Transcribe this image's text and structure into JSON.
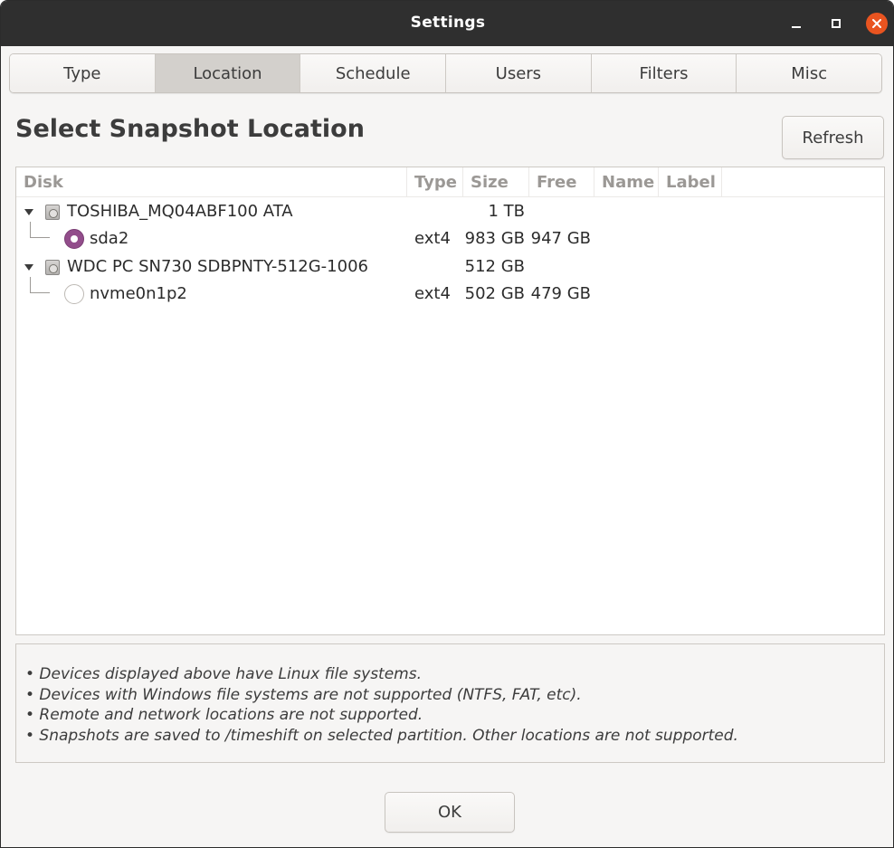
{
  "window": {
    "title": "Settings"
  },
  "tabs": [
    {
      "label": "Type",
      "active": false
    },
    {
      "label": "Location",
      "active": true
    },
    {
      "label": "Schedule",
      "active": false
    },
    {
      "label": "Users",
      "active": false
    },
    {
      "label": "Filters",
      "active": false
    },
    {
      "label": "Misc",
      "active": false
    }
  ],
  "page": {
    "heading": "Select Snapshot Location",
    "refresh_label": "Refresh"
  },
  "columns": [
    "Disk",
    "Type",
    "Size",
    "Free",
    "Name",
    "Label"
  ],
  "rows": [
    {
      "kind": "disk",
      "disk": "TOSHIBA_MQ04ABF100 ATA",
      "type": "",
      "size": "1 TB",
      "free": "",
      "name": "",
      "label": ""
    },
    {
      "kind": "partition",
      "selected": true,
      "disk": "sda2",
      "type": "ext4",
      "size": "983 GB",
      "free": "947 GB",
      "name": "",
      "label": ""
    },
    {
      "kind": "disk",
      "disk": "WDC PC SN730 SDBPNTY-512G-1006",
      "type": "",
      "size": "512 GB",
      "free": "",
      "name": "",
      "label": ""
    },
    {
      "kind": "partition",
      "selected": false,
      "disk": "nvme0n1p2",
      "type": "ext4",
      "size": "502 GB",
      "free": "479 GB",
      "name": "",
      "label": ""
    }
  ],
  "notes": [
    "• Devices displayed above have Linux file systems.",
    "• Devices with Windows file systems are not supported (NTFS, FAT, etc).",
    "• Remote and network locations are not supported.",
    "• Snapshots are saved to /timeshift on selected partition. Other locations are not supported."
  ],
  "footer": {
    "ok_label": "OK"
  },
  "colors": {
    "accent_radio": "#924d8b",
    "close_button": "#e95420",
    "titlebar": "#2f2f2f"
  }
}
